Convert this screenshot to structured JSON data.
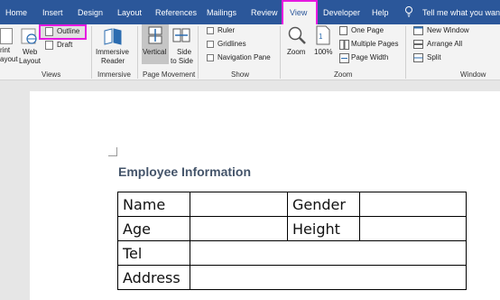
{
  "tabs": {
    "home": "Home",
    "insert": "Insert",
    "design": "Design",
    "layout": "Layout",
    "references": "References",
    "mailings": "Mailings",
    "review": "Review",
    "view": "View",
    "developer": "Developer",
    "help": "Help",
    "tell_me": "Tell me what you want t"
  },
  "ribbon": {
    "views": {
      "print_layout_1": "rint",
      "print_layout_2": "ayout",
      "web_layout_1": "Web",
      "web_layout_2": "Layout",
      "outline": "Outline",
      "draft": "Draft",
      "label": "Views"
    },
    "immersive": {
      "reader_1": "Immersive",
      "reader_2": "Reader",
      "label": "Immersive"
    },
    "page_movement": {
      "vertical": "Vertical",
      "side_1": "Side",
      "side_2": "to Side",
      "label": "Page Movement"
    },
    "show": {
      "ruler": "Ruler",
      "gridlines": "Gridlines",
      "navigation_pane": "Navigation Pane",
      "label": "Show"
    },
    "zoom": {
      "zoom": "Zoom",
      "hundred": "100%",
      "one_page": "One Page",
      "multiple_pages": "Multiple Pages",
      "page_width": "Page Width",
      "label": "Zoom"
    },
    "window": {
      "new_window": "New Window",
      "arrange_all": "Arrange All",
      "split": "Split",
      "label": "Window"
    }
  },
  "document": {
    "heading": "Employee Information",
    "table": {
      "name": "Name",
      "gender": "Gender",
      "age": "Age",
      "height": "Height",
      "tel": "Tel",
      "address": "Address"
    }
  },
  "colors": {
    "tab_bar": "#2b579a",
    "highlight": "#e619e0",
    "heading": "#44546a"
  }
}
